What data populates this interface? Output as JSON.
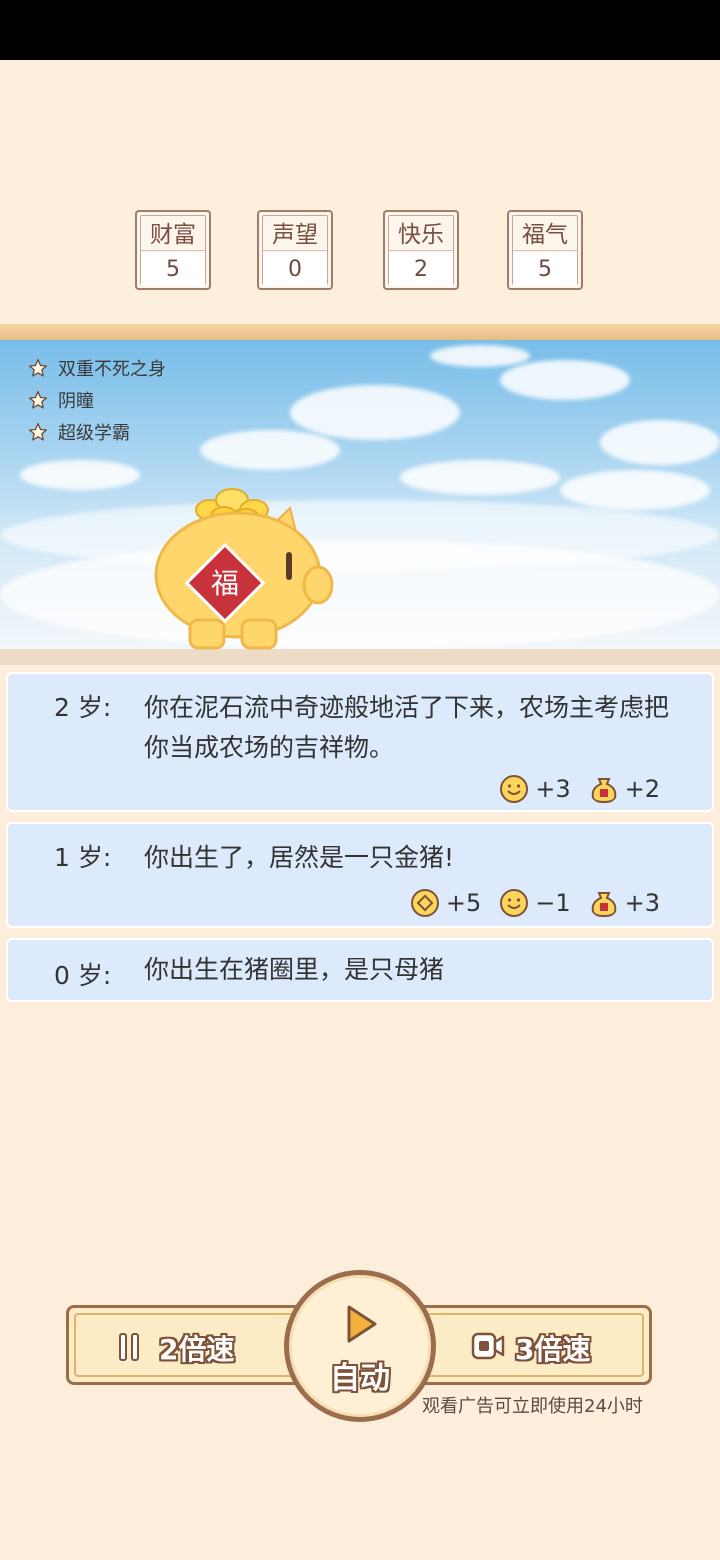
{
  "stats": [
    {
      "label": "财富",
      "value": "5"
    },
    {
      "label": "声望",
      "value": "0"
    },
    {
      "label": "快乐",
      "value": "2"
    },
    {
      "label": "福气",
      "value": "5"
    }
  ],
  "traits": [
    "双重不死之身",
    "阴瞳",
    "超级学霸"
  ],
  "log": [
    {
      "age": "2 岁:",
      "text": "你在泥石流中奇迹般地活了下来，农场主考虑把你当成农场的吉祥物。",
      "effects": [
        {
          "icon": "smile-icon",
          "value": "+3"
        },
        {
          "icon": "fortune-bag-icon",
          "value": "+2"
        }
      ]
    },
    {
      "age": "1 岁:",
      "text": "你出生了，居然是一只金猪!",
      "effects": [
        {
          "icon": "coin-icon",
          "value": "+5"
        },
        {
          "icon": "smile-icon",
          "value": "−1"
        },
        {
          "icon": "fortune-bag-icon",
          "value": "+3"
        }
      ]
    },
    {
      "age": "0 岁:",
      "text": "你出生在猪圈里，是只母猪",
      "effects": []
    }
  ],
  "controls": {
    "speed2_label": "2倍速",
    "auto_label": "自动",
    "speed3_label": "3倍速",
    "ad_hint": "观看广告可立即使用24小时"
  },
  "pig_badge": "福",
  "colors": {
    "accent": "#9c6d4a",
    "card": "#ddeafb",
    "bg": "#fdeedb"
  }
}
